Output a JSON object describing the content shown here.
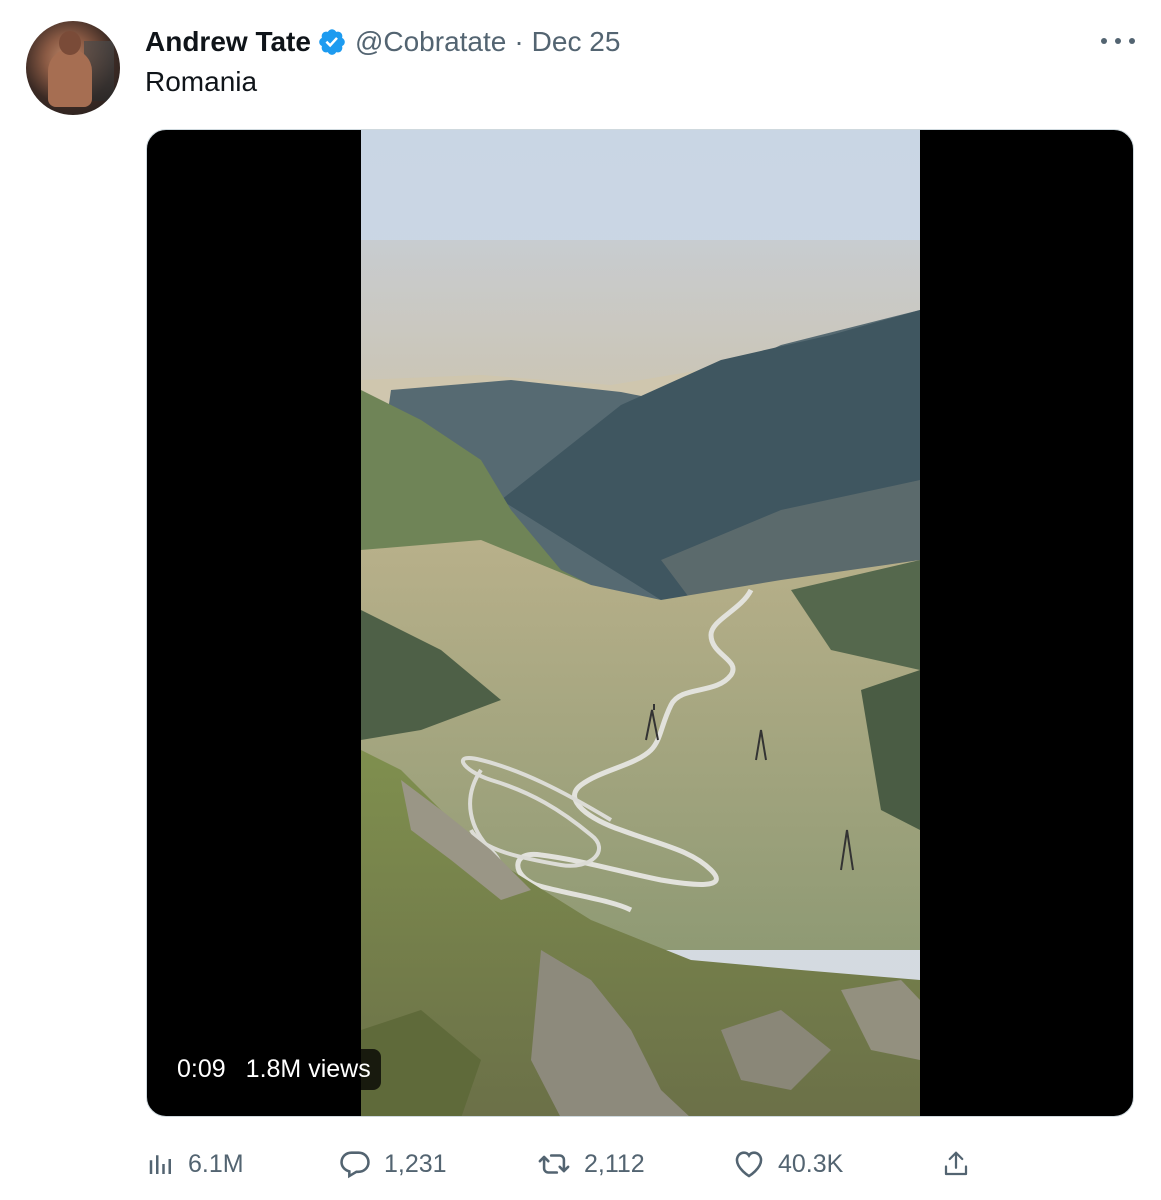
{
  "tweet": {
    "author_name": "Andrew Tate",
    "author_handle": "@Cobratate",
    "separator": "·",
    "date": "Dec 25",
    "text": "Romania",
    "verified": true,
    "verified_color": "#1d9bf0"
  },
  "video": {
    "duration": "0:09",
    "views": "1.8M views"
  },
  "actions": {
    "views": {
      "icon": "bar-chart-icon",
      "count": "6.1M"
    },
    "reply": {
      "icon": "reply-icon",
      "count": "1,231"
    },
    "retweet": {
      "icon": "retweet-icon",
      "count": "2,112"
    },
    "like": {
      "icon": "heart-icon",
      "count": "40.3K"
    },
    "share": {
      "icon": "share-icon"
    }
  },
  "colors": {
    "text_primary": "#0f1419",
    "text_secondary": "#536471",
    "accent": "#1d9bf0"
  }
}
